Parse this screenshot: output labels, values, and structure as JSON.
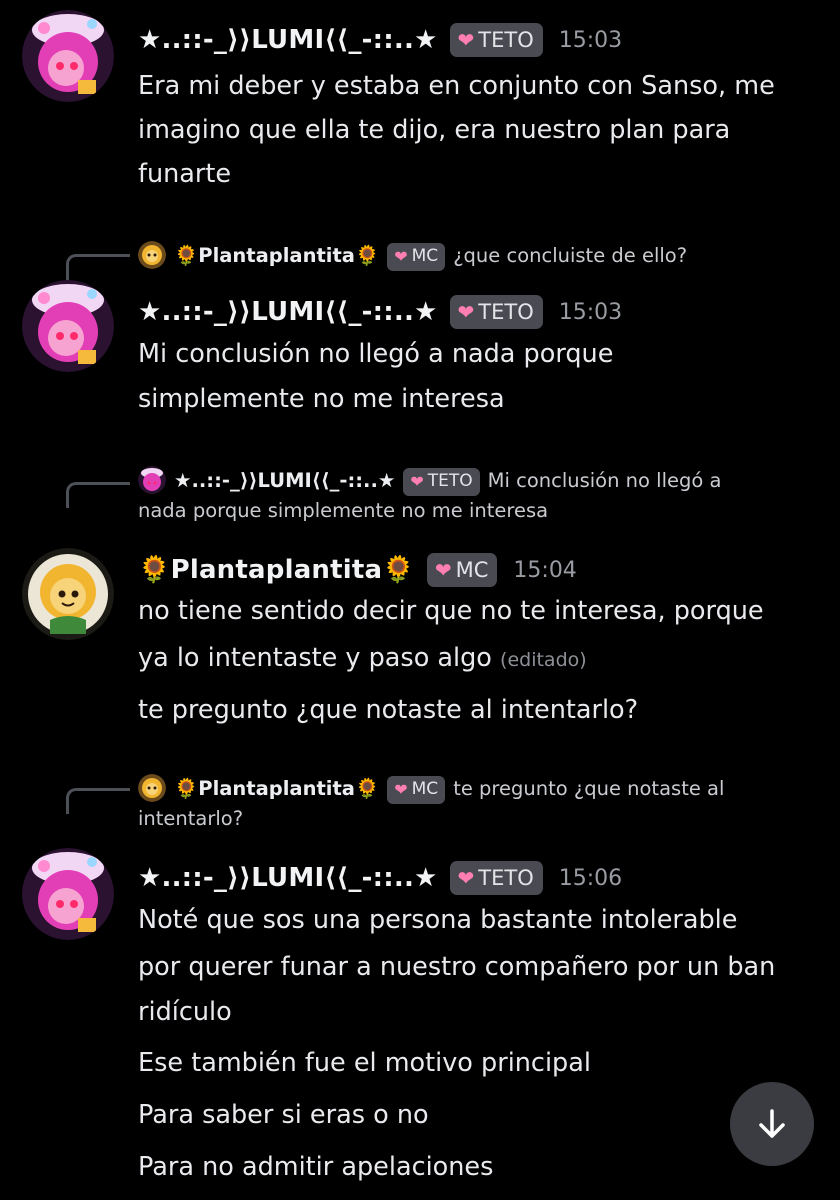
{
  "messages": [
    {
      "author": "★..::-_⟩⟩LUMI⟨⟨_-::..★",
      "tag": "TETO",
      "time": "15:03",
      "lines": [
        "Era mi deber y estaba en conjunto con Sanso, me",
        "imagino que ella te dijo, era nuestro plan para",
        "funarte"
      ]
    },
    {
      "reply": {
        "author": "🌻Plantaplantita🌻",
        "tag": "MC",
        "text": "¿que concluiste de ello?"
      },
      "author": "★..::-_⟩⟩LUMI⟨⟨_-::..★",
      "tag": "TETO",
      "time": "15:03",
      "lines": [
        "Mi conclusión no llegó a nada porque",
        "simplemente no me interesa"
      ]
    },
    {
      "reply": {
        "author": "★..::-_⟩⟩LUMI⟨⟨_-::..★",
        "tag": "TETO",
        "text_line1": "Mi conclusión no llegó a",
        "text_line2": "nada porque simplemente no me interesa"
      },
      "author": "🌻Plantaplantita🌻",
      "tag": "MC",
      "time": "15:04",
      "lines": [
        "no tiene sentido decir que no te interesa, porque",
        "ya lo intentaste y paso algo",
        "te pregunto ¿que notaste al intentarlo?"
      ],
      "edited": "(editado)"
    },
    {
      "reply": {
        "author": "🌻Plantaplantita🌻",
        "tag": "MC",
        "text_line1": "te pregunto ¿que notaste al",
        "text_line2": "intentarlo?"
      },
      "author": "★..::-_⟩⟩LUMI⟨⟨_-::..★",
      "tag": "TETO",
      "time": "15:06",
      "lines": [
        "Noté que sos una persona bastante intolerable",
        "por querer funar a nuestro compañero por un ban",
        "ridículo",
        "Ese también fue el motivo principal",
        "Para saber si eras o no",
        "Para no admitir apelaciones"
      ]
    }
  ],
  "icons": {
    "tag_heart": "heart-icon",
    "scroll_down": "arrow-down-icon"
  },
  "colors": {
    "background": "#000000",
    "tag_bg": "#4a4b52",
    "heart": "#ff7fb3",
    "timestamp": "#9a9ca3"
  }
}
